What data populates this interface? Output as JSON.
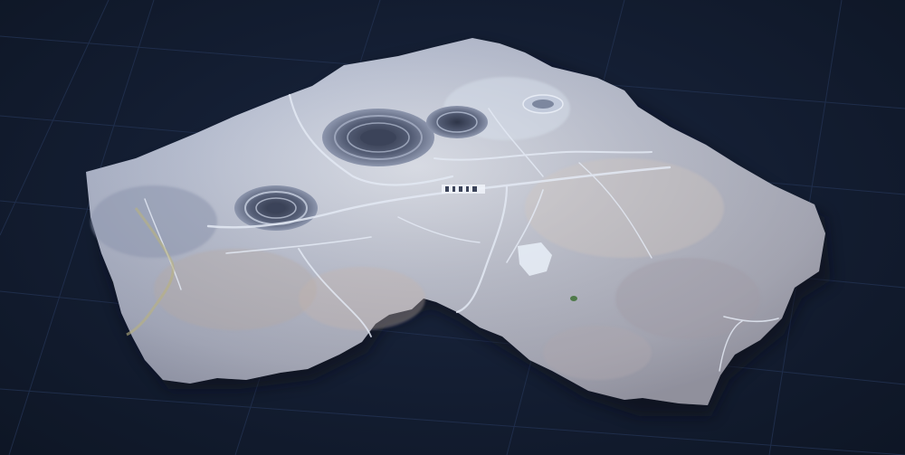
{
  "scene": {
    "subject": "mine-terrain-3d-model",
    "colors": {
      "background": "#131d31",
      "grid_line": "#223150",
      "terrain_light": "#c9d3e6",
      "terrain_mid": "#a9b3c9",
      "terrain_shadow": "#5d6782",
      "pit_dark": "#3b4359",
      "road": "#dfe6f2"
    }
  }
}
